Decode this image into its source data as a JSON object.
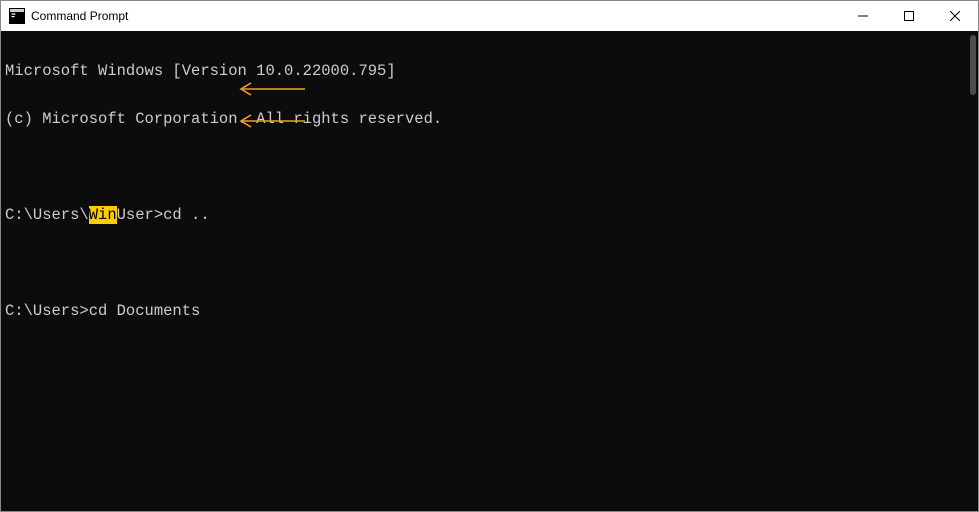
{
  "window": {
    "title": "Command Prompt"
  },
  "terminal": {
    "line1": "Microsoft Windows [Version 10.0.22000.795]",
    "line2": "(c) Microsoft Corporation. All rights reserved.",
    "prompt1_before": "C:\\Users\\",
    "prompt1_match": "Win",
    "prompt1_after": "User>cd ..",
    "prompt2": "C:\\Users>cd Documents"
  },
  "colors": {
    "arrow": "#f0a020"
  }
}
